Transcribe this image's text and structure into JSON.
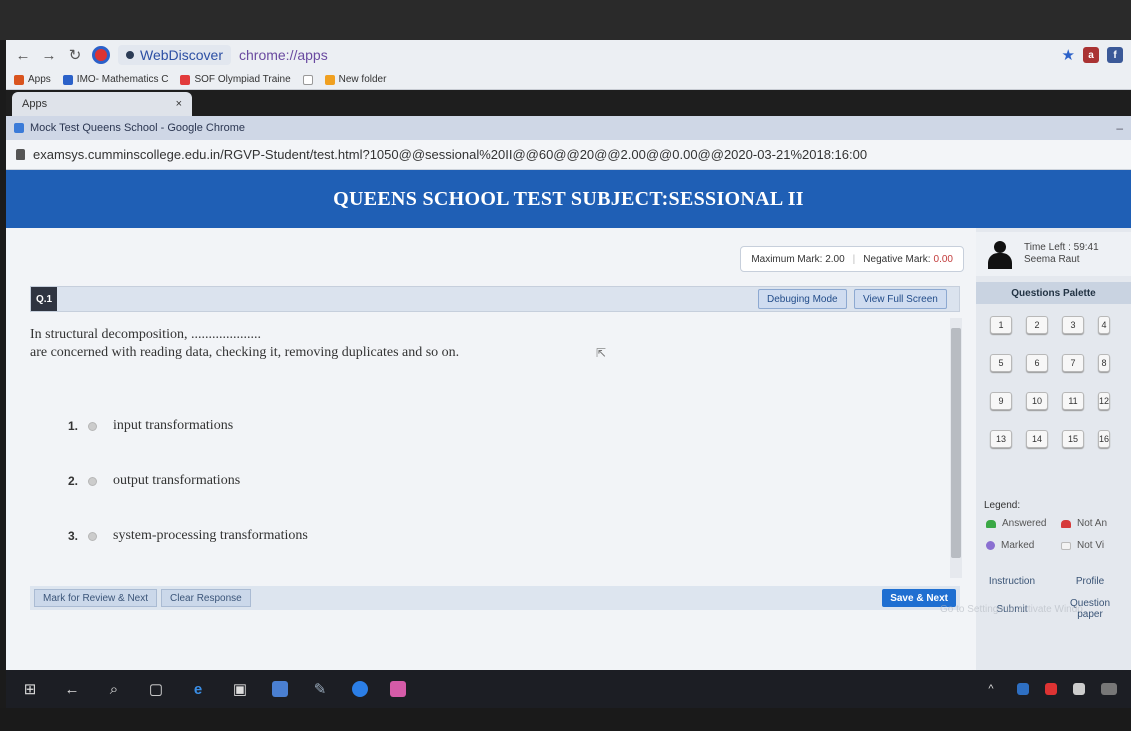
{
  "browser": {
    "search_text": "WebDiscover",
    "url": "chrome://apps",
    "bookmarks": [
      "Apps",
      "IMO- Mathematics C",
      "SOF Olympiad Traine",
      "New folder"
    ],
    "tab_label": "Apps",
    "tab_close": "×"
  },
  "inner_window": {
    "title": "Mock Test Queens School - Google Chrome",
    "url": "examsys.cumminscollege.edu.in/RGVP-Student/test.html?1050@@sessional%20II@@60@@20@@2.00@@0.00@@2020-03-21%2018:16:00"
  },
  "test": {
    "banner_title": "QUEENS SCHOOL TEST SUBJECT:SESSIONAL II",
    "max_mark": "Maximum Mark: 2.00",
    "neg_mark_label": "Negative Mark:",
    "neg_mark_value": "0.00",
    "question_number": "Q.1",
    "debug_btn": "Debuging Mode",
    "fullscreen_btn": "View Full Screen",
    "question_line1": "In structural decomposition, ....................",
    "question_line2": "are concerned with reading data, checking it, removing duplicates and so on.",
    "options": [
      {
        "num": "1.",
        "text": "input transformations"
      },
      {
        "num": "2.",
        "text": "output transformations"
      },
      {
        "num": "3.",
        "text": "system-processing transformations"
      }
    ],
    "mark_review_btn": "Mark for Review & Next",
    "clear_btn": "Clear Response",
    "save_btn": "Save & Next"
  },
  "side": {
    "time_left": "Time Left : 59:41",
    "user_name": "Seema Raut",
    "palette_title": "Questions Palette",
    "questions": [
      "1",
      "2",
      "3",
      "4",
      "5",
      "6",
      "7",
      "8",
      "9",
      "10",
      "11",
      "12",
      "13",
      "14",
      "15",
      "16"
    ],
    "legend_title": "Legend:",
    "legend": [
      {
        "label": "Answered",
        "color": "#3aa845"
      },
      {
        "label": "Not An",
        "color": "#d63a3a"
      },
      {
        "label": "Marked",
        "color": "#8a6fd1"
      },
      {
        "label": "Not Vi",
        "color": "#f3f3f3"
      }
    ],
    "instruction_tab": "Instruction",
    "profile_tab": "Profile",
    "submit_tab": "Submit",
    "question_paper_tab": "Question paper",
    "watermark": "Go to Settings to activate Windo"
  },
  "colors": {
    "banner": "#1f5fb5",
    "save": "#1f6fd1"
  }
}
